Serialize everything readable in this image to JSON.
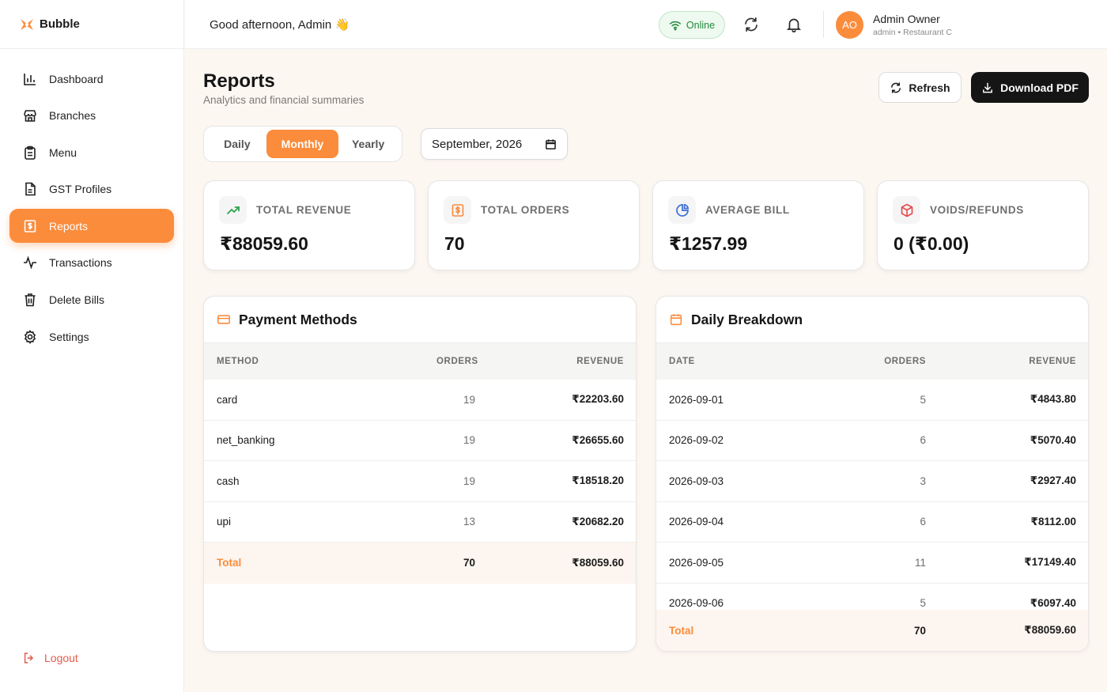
{
  "brand": {
    "name": "Bubble"
  },
  "sidebar": {
    "items": [
      {
        "label": "Dashboard",
        "icon": "bar-chart-icon"
      },
      {
        "label": "Branches",
        "icon": "store-icon"
      },
      {
        "label": "Menu",
        "icon": "clipboard-icon"
      },
      {
        "label": "GST Profiles",
        "icon": "document-icon"
      },
      {
        "label": "Reports",
        "icon": "dollar-receipt-icon",
        "active": true
      },
      {
        "label": "Transactions",
        "icon": "activity-icon"
      },
      {
        "label": "Delete Bills",
        "icon": "trash-icon"
      },
      {
        "label": "Settings",
        "icon": "gear-icon"
      }
    ],
    "logout_label": "Logout"
  },
  "header": {
    "greeting": "Good afternoon, Admin 👋",
    "status": "Online",
    "user": {
      "initials": "AO",
      "name": "Admin Owner",
      "role": "admin • Restaurant C"
    }
  },
  "page": {
    "title": "Reports",
    "subtitle": "Analytics and financial summaries",
    "refresh_label": "Refresh",
    "download_label": "Download PDF"
  },
  "filters": {
    "periods": [
      "Daily",
      "Monthly",
      "Yearly"
    ],
    "active_period": "Monthly",
    "month_value": "September, 2026"
  },
  "stats": [
    {
      "label": "TOTAL REVENUE",
      "value": "₹88059.60",
      "icon": "trending-up-icon",
      "color": "#2ea44f"
    },
    {
      "label": "TOTAL ORDERS",
      "value": "70",
      "icon": "receipt-icon",
      "color": "#fb8c3c"
    },
    {
      "label": "AVERAGE BILL",
      "value": "₹1257.99",
      "icon": "pie-chart-icon",
      "color": "#3b6fd8"
    },
    {
      "label": "VOIDS/REFUNDS",
      "value": "0 (₹0.00)",
      "icon": "box-icon",
      "color": "#e54848"
    }
  ],
  "payment_methods": {
    "title": "Payment Methods",
    "columns": [
      "METHOD",
      "ORDERS",
      "REVENUE"
    ],
    "rows": [
      {
        "method": "card",
        "orders": "19",
        "revenue": "₹22203.60"
      },
      {
        "method": "net_banking",
        "orders": "19",
        "revenue": "₹26655.60"
      },
      {
        "method": "cash",
        "orders": "19",
        "revenue": "₹18518.20"
      },
      {
        "method": "upi",
        "orders": "13",
        "revenue": "₹20682.20"
      }
    ],
    "total": {
      "label": "Total",
      "orders": "70",
      "revenue": "₹88059.60"
    }
  },
  "daily_breakdown": {
    "title": "Daily Breakdown",
    "columns": [
      "DATE",
      "ORDERS",
      "REVENUE"
    ],
    "rows": [
      {
        "date": "2026-09-01",
        "orders": "5",
        "revenue": "₹4843.80"
      },
      {
        "date": "2026-09-02",
        "orders": "6",
        "revenue": "₹5070.40"
      },
      {
        "date": "2026-09-03",
        "orders": "3",
        "revenue": "₹2927.40"
      },
      {
        "date": "2026-09-04",
        "orders": "6",
        "revenue": "₹8112.00"
      },
      {
        "date": "2026-09-05",
        "orders": "11",
        "revenue": "₹17149.40"
      },
      {
        "date": "2026-09-06",
        "orders": "5",
        "revenue": "₹6097.40"
      }
    ],
    "total": {
      "label": "Total",
      "orders": "70",
      "revenue": "₹88059.60"
    }
  },
  "colors": {
    "accent": "#fb8c3c",
    "dark": "#151515",
    "online": "#1f8a3a",
    "logout": "#e65a4a"
  }
}
